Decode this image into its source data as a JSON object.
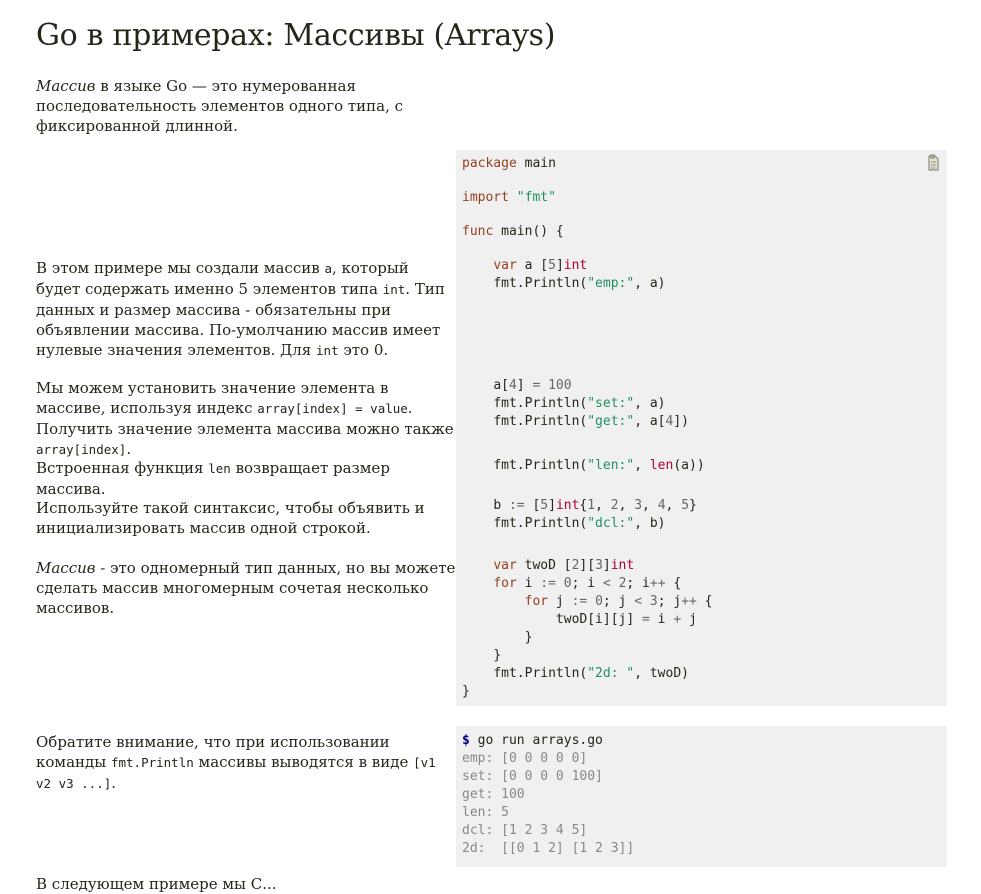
{
  "page": {
    "title": "Go в примерах: Массивы (Arrays)"
  },
  "intro": {
    "term": "Массив",
    "text": " в языке Go — это нумерованная последовательность элементов одного типа, с фиксированной длинной."
  },
  "sections": [
    {
      "p1": "В этом примере мы создали массив ",
      "c1": "a",
      "p2": ", который будет содержать именно 5 элементов типа ",
      "c2": "int",
      "p3": ". Тип данных и размер массива - обязательны при объявлении массива. По-умолчанию массив имеет нулевые значения элементов. Для ",
      "c3": "int",
      "p4": " это 0."
    },
    {
      "p1": "Мы можем установить значение элемента в массиве, используя индекс ",
      "c1": "array[index] = value",
      "p2": ". Получить значение элемента массива можно также ",
      "c2": "array[index]",
      "p3": "."
    },
    {
      "p1": "Встроенная функция ",
      "c1": "len",
      "p2": " возвращает размер массива."
    },
    {
      "p1": "Используйте такой синтаксис, чтобы объявить и инициализировать массив одной строкой."
    },
    {
      "term": "Массив",
      "p1": " - это одномерный тип данных, но вы можете сделать массив многомерным сочетая несколько массивов."
    }
  ],
  "code": {
    "package_kw": "package",
    "package_name": " main",
    "import_kw": "import",
    "import_path": "\"fmt\"",
    "func_kw": "func",
    "func_sig": " main() {",
    "decl_var_kw": "var",
    "decl_rest": " a [",
    "decl_size": "5",
    "decl_close": "]",
    "decl_type": "int",
    "emp_call": "fmt.Println(",
    "emp_str": "\"emp:\"",
    "emp_tail": ", a)",
    "set_lhs": "a[",
    "set_idx": "4",
    "set_mid": "] ",
    "set_eq": "=",
    "set_sp": " ",
    "set_val": "100",
    "set_call": "fmt.Println(",
    "set_str": "\"set:\"",
    "set_tail": ", a)",
    "get_call": "fmt.Println(",
    "get_str": "\"get:\"",
    "get_tail_a": ", a[",
    "get_idx": "4",
    "get_tail_b": "])",
    "len_call": "fmt.Println(",
    "len_str": "\"len:\"",
    "len_mid": ", ",
    "len_fn": "len",
    "len_tail": "(a))",
    "b_lhs": "b ",
    "b_op": ":=",
    "b_sp": " [",
    "b_size": "5",
    "b_close": "]",
    "b_type": "int",
    "b_open": "{",
    "b_v1": "1",
    "b_v2": "2",
    "b_v3": "3",
    "b_v4": "4",
    "b_v5": "5",
    "b_sep": ", ",
    "b_end": "}",
    "dcl_call": "fmt.Println(",
    "dcl_str": "\"dcl:\"",
    "dcl_tail": ", b)",
    "two_var_kw": "var",
    "two_name": " twoD [",
    "two_d1": "2",
    "two_mid": "][",
    "two_d2": "3",
    "two_close": "]",
    "two_type": "int",
    "for1_kw": "for",
    "for1_a": " i ",
    "for1_op1": ":=",
    "for1_sp": " ",
    "for1_zero": "0",
    "for1_b": "; i ",
    "for1_lt": "<",
    "for1_lim": "2",
    "for1_c": "; i",
    "for1_inc": "++",
    "for1_d": " {",
    "for2_kw": "for",
    "for2_a": " j ",
    "for2_op1": ":=",
    "for2_sp": " ",
    "for2_zero": "0",
    "for2_b": "; j ",
    "for2_lt": "<",
    "for2_lim": "3",
    "for2_c": "; j",
    "for2_inc": "++",
    "for2_d": " {",
    "assign_a": "twoD[i][j] ",
    "assign_eq": "=",
    "assign_b": " i ",
    "assign_plus": "+",
    "assign_c": " j",
    "close_inner": "}",
    "close_outer": "}",
    "twod_call": "fmt.Println(",
    "twod_str": "\"2d: \"",
    "twod_tail": ", twoD)",
    "close_func": "}"
  },
  "footer_note": {
    "p1": "Обратите внимание, что при использовании команды ",
    "c1": "fmt.Println",
    "p2": " массивы выводятся в виде ",
    "c2": "[v1 v2 v3 ...]",
    "p3": "."
  },
  "shell": {
    "prompt": "$",
    "command": " go run arrays.go",
    "output": [
      "emp: [0 0 0 0 0]",
      "set: [0 0 0 0 100]",
      "get: 100",
      "len: 5",
      "dcl: [1 2 3 4 5]",
      "2d:  [[0 1 2] [1 2 3]]"
    ]
  },
  "cut_text": "В следующем примере мы С..."
}
